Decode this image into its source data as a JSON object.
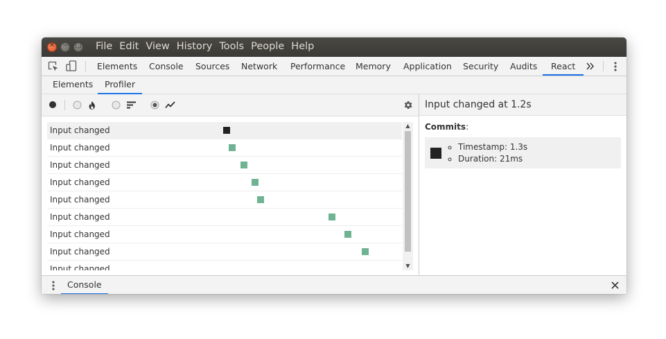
{
  "menubar": {
    "items": [
      "File",
      "Edit",
      "View",
      "History",
      "Tools",
      "People",
      "Help"
    ]
  },
  "devtools_tabs": [
    "Elements",
    "Console",
    "Sources",
    "Network",
    "Performance",
    "Memory",
    "Application",
    "Security",
    "Audits",
    "React"
  ],
  "active_devtools_tab": "React",
  "react_tabs": [
    "Elements",
    "Profiler"
  ],
  "active_react_tab": "Profiler",
  "profiler_toolbar": {
    "icons": [
      "record-icon",
      "flame-chart-icon",
      "ranked-chart-icon",
      "interactions-chart-icon",
      "settings-gear-icon"
    ],
    "selected_view": "interactions"
  },
  "interaction_rows": [
    {
      "label": "Input changed",
      "commit_time_fraction": 0.0,
      "selected": true
    },
    {
      "label": "Input changed",
      "commit_time_fraction": 0.04,
      "selected": false
    },
    {
      "label": "Input changed",
      "commit_time_fraction": 0.12,
      "selected": false
    },
    {
      "label": "Input changed",
      "commit_time_fraction": 0.2,
      "selected": false
    },
    {
      "label": "Input changed",
      "commit_time_fraction": 0.24,
      "selected": false
    },
    {
      "label": "Input changed",
      "commit_time_fraction": 0.74,
      "selected": false
    },
    {
      "label": "Input changed",
      "commit_time_fraction": 0.85,
      "selected": false
    },
    {
      "label": "Input changed",
      "commit_time_fraction": 0.97,
      "selected": false
    },
    {
      "label": "Input changed",
      "commit_time_fraction": null,
      "selected": false
    }
  ],
  "side_panel": {
    "title": "Input changed at 1.2s",
    "commits_label": "Commits",
    "commits_colon": ":",
    "commit": {
      "timestamp": "Timestamp: 1.3s",
      "duration": "Duration: 21ms"
    }
  },
  "drawer": {
    "tab_label": "Console"
  },
  "colors": {
    "selected_commit": "#222222",
    "commit": "#6fb393",
    "accent": "#1a73e8",
    "titlebar": "#3c3b37",
    "close_button": "#e95420"
  }
}
